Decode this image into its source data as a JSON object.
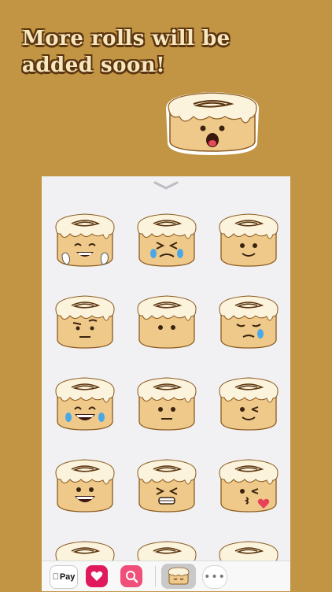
{
  "promo": {
    "headline": "More rolls will be added soon!"
  },
  "stickers": [
    {
      "name": "grinning-hands"
    },
    {
      "name": "crying-squint"
    },
    {
      "name": "smile"
    },
    {
      "name": "skeptical"
    },
    {
      "name": "neutral-dots"
    },
    {
      "name": "sad-tear"
    },
    {
      "name": "laugh-tears"
    },
    {
      "name": "expressionless"
    },
    {
      "name": "wink"
    },
    {
      "name": "big-grin"
    },
    {
      "name": "grimace"
    },
    {
      "name": "kiss-heart"
    },
    {
      "name": "partial-1"
    },
    {
      "name": "partial-2"
    },
    {
      "name": "partial-3"
    }
  ],
  "toolbar": {
    "apple_pay_label": "Pay",
    "apps": [
      "apple-pay",
      "heart-stickers",
      "search-images",
      "cinnamon-roll-stickers",
      "more"
    ]
  },
  "colors": {
    "background": "#c29545",
    "headline": "#f7e7bf",
    "outline": "#5b3510",
    "dough": "#efc98a",
    "icing": "#fbf3dc"
  }
}
